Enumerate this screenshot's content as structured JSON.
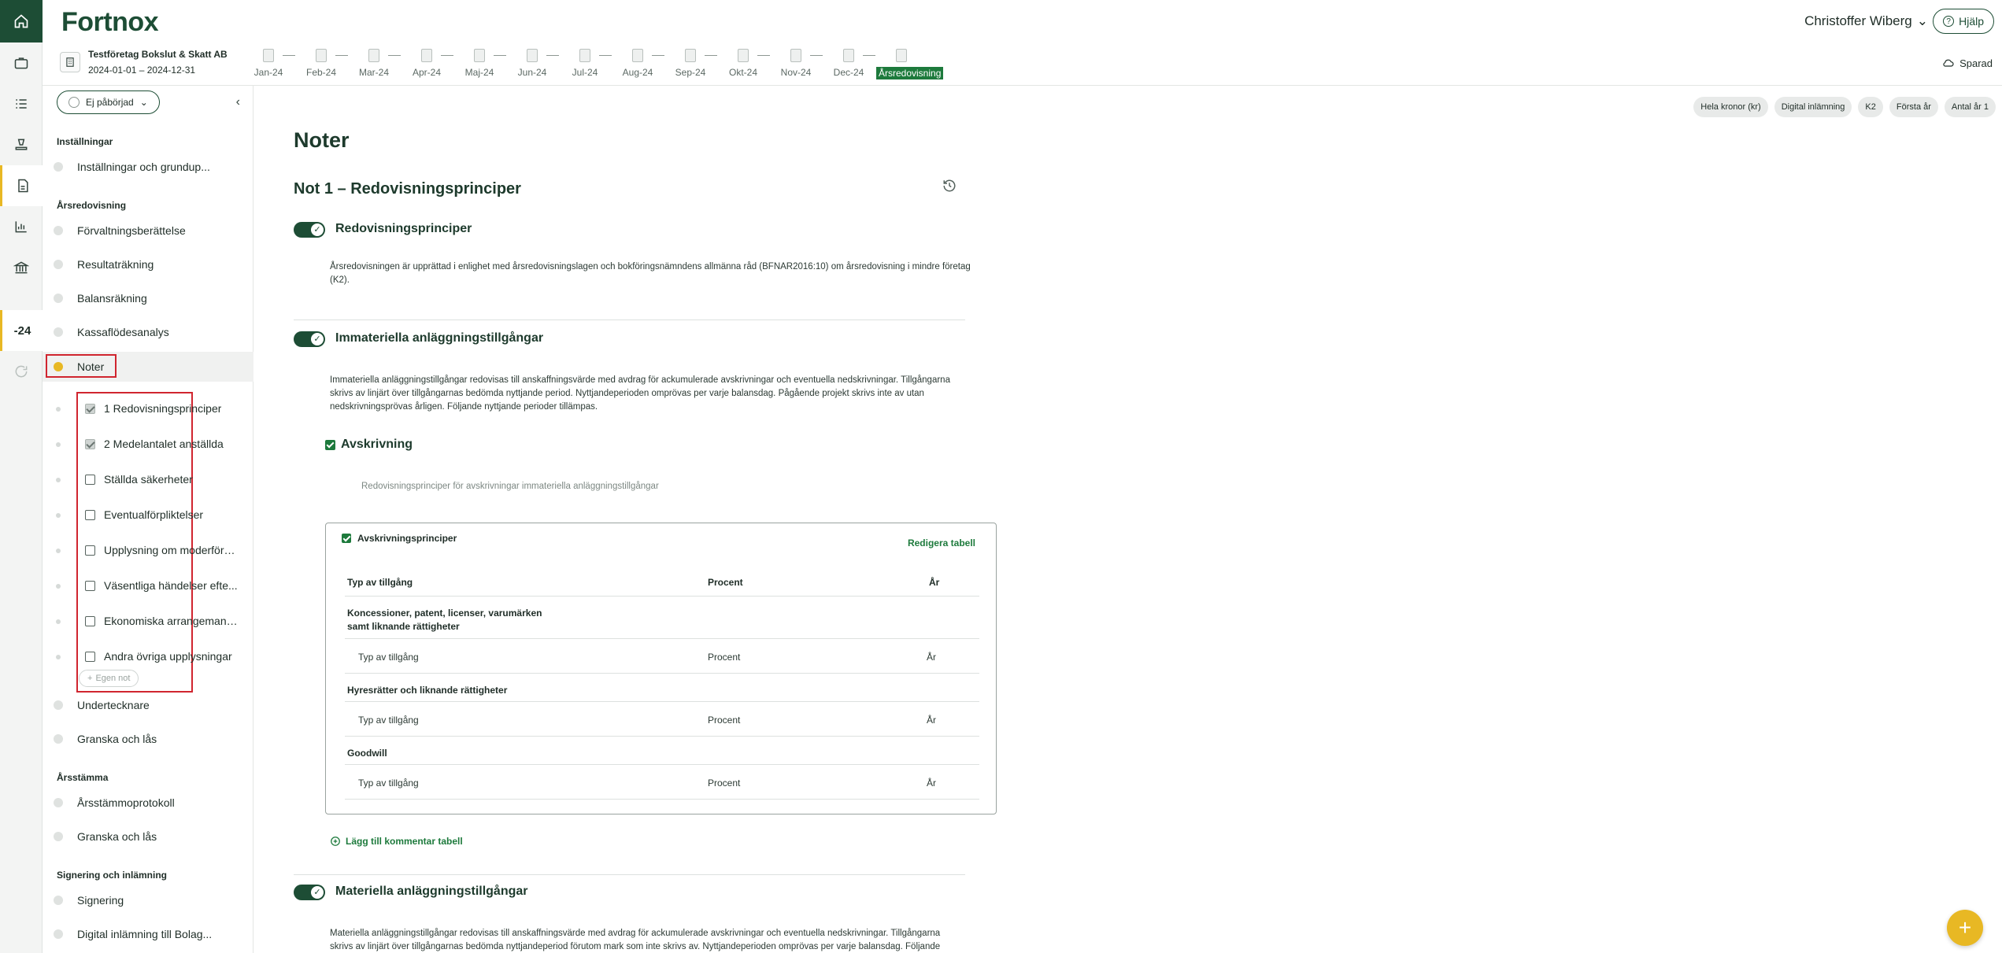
{
  "app": {
    "logo": "Fortnox",
    "user": "Christoffer Wiberg",
    "help_label": "Hjälp",
    "saved_label": "Sparad"
  },
  "rail": {
    "year_label": "-24"
  },
  "company": {
    "name": "Testföretag Bokslut & Skatt AB",
    "period": "2024-01-01 – 2024-12-31"
  },
  "months": [
    "Jan-24",
    "Feb-24",
    "Mar-24",
    "Apr-24",
    "Maj-24",
    "Jun-24",
    "Jul-24",
    "Aug-24",
    "Sep-24",
    "Okt-24",
    "Nov-24",
    "Dec-24",
    "Årsredovisning"
  ],
  "sidebar": {
    "status": "Ej påbörjad",
    "sections": {
      "installningar": "Inställningar",
      "arsredovisning": "Årsredovisning",
      "arsstamma": "Årsstämma",
      "signering": "Signering och inlämning"
    },
    "items": {
      "installningar_grund": "Inställningar och grundup...",
      "forvaltning": "Förvaltningsberättelse",
      "resultat": "Resultaträkning",
      "balans": "Balansräkning",
      "kassaflode": "Kassaflödesanalys",
      "noter": "Noter",
      "undertecknare": "Undertecknare",
      "granska1": "Granska och lås",
      "arsstammoprotokoll": "Årsstämmoprotokoll",
      "granska2": "Granska och lås",
      "signering": "Signering",
      "digital": "Digital inlämning till Bolag..."
    },
    "notes": [
      "1 Redovisningsprinciper",
      "2 Medelantalet anställda",
      "Ställda säkerheter",
      "Eventualförpliktelser",
      "Upplysning om moderföre...",
      "Väsentliga händelser efte...",
      "Ekonomiska arrangemang...",
      "Andra övriga upplysningar"
    ],
    "egen_not": "Egen not"
  },
  "chips": [
    "Hela kronor (kr)",
    "Digital inlämning",
    "K2",
    "Första år",
    "Antal år 1"
  ],
  "main": {
    "title": "Noter",
    "note_title": "Not 1 – Redovisningsprinciper",
    "s1_title": "Redovisningsprinciper",
    "s1_text": "Årsredovisningen är upprättad i enlighet med årsredovisningslagen och bokföringsnämndens allmänna råd (BFNAR2016:10) om årsredovisning i mindre företag (K2).",
    "s2_title": "Immateriella anläggningstillgångar",
    "s2_text": "Immateriella anläggningstillgångar redovisas till anskaffningsvärde med avdrag för ackumulerade avskrivningar och eventuella nedskrivningar. Tillgångarna skrivs av linjärt över tillgångarnas bedömda nyttjande period. Nyttjandeperioden omprövas per varje balansdag. Pågående projekt skrivs inte av utan nedskrivningsprövas årligen. Följande nyttjande perioder tillämpas.",
    "avskrivning_title": "Avskrivning",
    "avskrivning_placeholder": "Redovisningsprinciper för avskrivningar immateriella anläggningstillgångar",
    "table": {
      "name": "Avskrivningsprinciper",
      "edit": "Redigera tabell",
      "headers": [
        "Typ av tillgång",
        "Procent",
        "År"
      ],
      "groups": [
        {
          "title_line1": "Koncessioner, patent, licenser, varumärken",
          "title_line2": "samt liknande rättigheter",
          "cells": [
            "Typ av tillgång",
            "Procent",
            "År"
          ]
        },
        {
          "title_line1": "Hyresrätter och liknande rättigheter",
          "title_line2": "",
          "cells": [
            "Typ av tillgång",
            "Procent",
            "År"
          ]
        },
        {
          "title_line1": "Goodwill",
          "title_line2": "",
          "cells": [
            "Typ av tillgång",
            "Procent",
            "År"
          ]
        }
      ]
    },
    "add_comment": "Lägg till kommentar tabell",
    "s3_title": "Materiella anläggningstillgångar",
    "s3_text_line1": "Materiella anläggningstillgångar redovisas till anskaffningsvärde med avdrag för ackumulerade avskrivningar och eventuella nedskrivningar. Tillgångarna",
    "s3_text_line2": "skrivs av linjärt över tillgångarnas bedömda nyttjandeperiod förutom mark som inte skrivs av. Nyttjandeperioden omprövas per varje balansdag. Följande"
  }
}
